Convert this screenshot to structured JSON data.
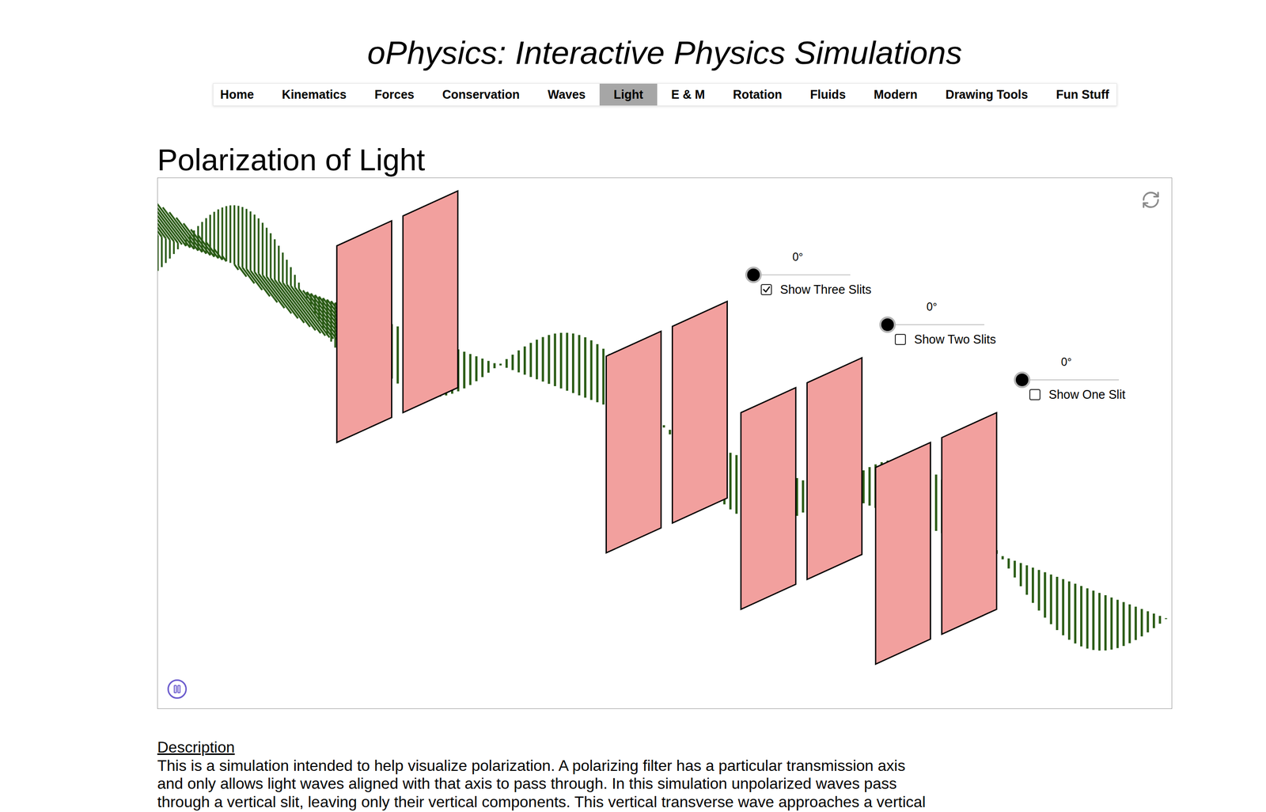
{
  "site": {
    "title": "oPhysics: Interactive Physics Simulations"
  },
  "nav": [
    {
      "label": "Home",
      "selected": false
    },
    {
      "label": "Kinematics",
      "selected": false
    },
    {
      "label": "Forces",
      "selected": false
    },
    {
      "label": "Conservation",
      "selected": false
    },
    {
      "label": "Waves",
      "selected": false
    },
    {
      "label": "Light",
      "selected": true
    },
    {
      "label": "E & M",
      "selected": false
    },
    {
      "label": "Rotation",
      "selected": false
    },
    {
      "label": "Fluids",
      "selected": false
    },
    {
      "label": "Modern",
      "selected": false
    },
    {
      "label": "Drawing Tools",
      "selected": false
    },
    {
      "label": "Fun Stuff",
      "selected": false
    }
  ],
  "page": {
    "title": "Polarization of Light"
  },
  "simulation": {
    "playing": true,
    "controls": [
      {
        "angle": "0°",
        "level": 0,
        "label": "Show Three Slits",
        "checked": true
      },
      {
        "angle": "0°",
        "level": 0,
        "label": "Show Two Slits",
        "checked": false
      },
      {
        "angle": "0°",
        "level": 0,
        "label": "Show One Slit",
        "checked": false
      }
    ]
  },
  "description": {
    "heading": "Description",
    "lines": [
      "This is a simulation intended to help visualize polarization. A polarizing filter has a particular transmission axis",
      "and only allows light waves aligned with that axis to pass through. In this simulation unpolarized waves pass",
      "through a vertical slit, leaving only their vertical components. This vertical transverse wave approaches a vertical"
    ]
  }
}
